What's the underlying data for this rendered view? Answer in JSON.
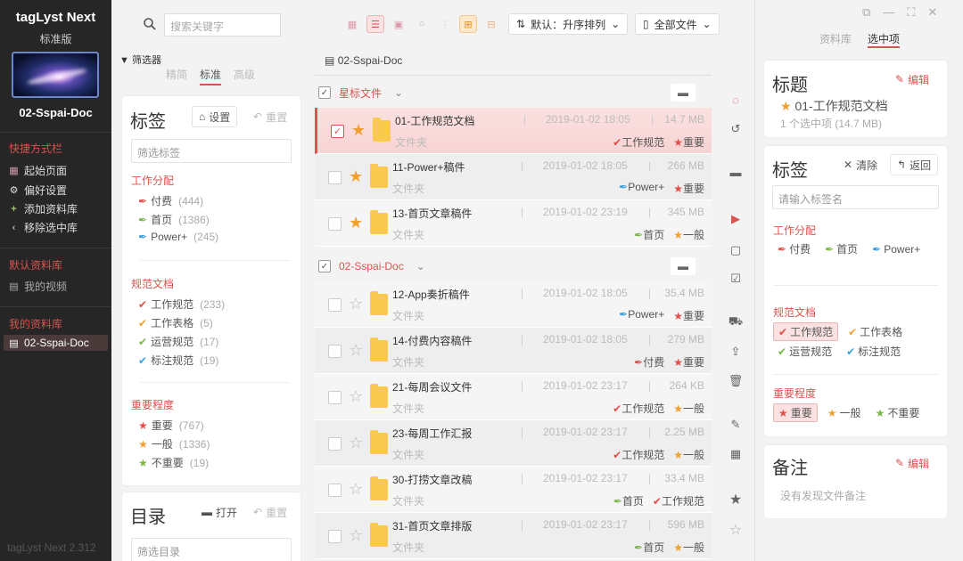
{
  "sidebar": {
    "app_title": "tagLyst Next",
    "edition": "标准版",
    "library_name": "02-Sspai-Doc",
    "shortcuts_title": "快捷方式栏",
    "shortcuts": [
      {
        "label": "起始页面",
        "icon": "grid-icon"
      },
      {
        "label": "偏好设置",
        "icon": "gear-icon"
      },
      {
        "label": "添加资料库",
        "icon": "plus-icon"
      },
      {
        "label": "移除选中库",
        "icon": "chevron-left-icon"
      }
    ],
    "default_libs_title": "默认资料库",
    "default_libs": [
      {
        "label": "我的视频"
      }
    ],
    "my_libs_title": "我的资料库",
    "my_libs": [
      {
        "label": "02-Sspai-Doc"
      }
    ],
    "version": "tagLyst Next 2.312"
  },
  "filter": {
    "search_placeholder": "搜索关键字",
    "label": "筛选器",
    "tabs": [
      "精简",
      "标准",
      "高级"
    ],
    "active_tab": 1,
    "tags_card": {
      "title": "标签",
      "settings": "设置",
      "reset": "重置",
      "input_placeholder": "筛选标签",
      "groups": [
        {
          "name": "工作分配",
          "items": [
            {
              "label": "付费",
              "count": "(444)",
              "color": "#e0504a",
              "icon": "pen-icon"
            },
            {
              "label": "首页",
              "count": "(1386)",
              "color": "#7ab648",
              "icon": "pen-icon"
            },
            {
              "label": "Power+",
              "count": "(245)",
              "color": "#3aa0e0",
              "icon": "pen-icon"
            }
          ]
        },
        {
          "name": "规范文档",
          "items": [
            {
              "label": "工作规范",
              "count": "(233)",
              "color": "#e0504a",
              "icon": "check-icon"
            },
            {
              "label": "工作表格",
              "count": "(5)",
              "color": "#f0a030",
              "icon": "check-icon"
            },
            {
              "label": "运营规范",
              "count": "(17)",
              "color": "#7ab648",
              "icon": "check-icon"
            },
            {
              "label": "标注规范",
              "count": "(19)",
              "color": "#3aa0e0",
              "icon": "check-icon"
            }
          ]
        },
        {
          "name": "重要程度",
          "items": [
            {
              "label": "重要",
              "count": "(767)",
              "color": "#e0504a",
              "icon": "star-icon"
            },
            {
              "label": "一般",
              "count": "(1336)",
              "color": "#f0a030",
              "icon": "star-icon"
            },
            {
              "label": "不重要",
              "count": "(19)",
              "color": "#7ab648",
              "icon": "star-icon"
            }
          ]
        }
      ]
    },
    "dir_card": {
      "title": "目录",
      "open": "打开",
      "reset": "重置",
      "input_placeholder": "筛选目录"
    }
  },
  "toolbar": {
    "sort_label": "默认：升序排列",
    "scope_label": "全部文件"
  },
  "main": {
    "path": "02-Sspai-Doc",
    "groups": [
      {
        "title": "星标文件",
        "rows": [
          {
            "name": "01-工作规范文档",
            "type": "文件夹",
            "date": "2019-01-02 18:05",
            "size": "14.7 MB",
            "starred": true,
            "selected": true,
            "tags": [
              {
                "label": "工作规范",
                "color": "#e0504a",
                "icon": "check-icon"
              },
              {
                "label": "重要",
                "color": "#e0504a",
                "icon": "star-icon"
              }
            ]
          },
          {
            "name": "11-Power+稿件",
            "type": "文件夹",
            "date": "2019-01-02 18:05",
            "size": "266 MB",
            "starred": true,
            "tags": [
              {
                "label": "Power+",
                "color": "#3aa0e0",
                "icon": "pen-icon"
              },
              {
                "label": "重要",
                "color": "#e0504a",
                "icon": "star-icon"
              }
            ]
          },
          {
            "name": "13-首页文章稿件",
            "type": "文件夹",
            "date": "2019-01-02 23:19",
            "size": "345 MB",
            "starred": true,
            "tags": [
              {
                "label": "首页",
                "color": "#7ab648",
                "icon": "pen-icon"
              },
              {
                "label": "一般",
                "color": "#f0a030",
                "icon": "star-icon"
              }
            ]
          }
        ]
      },
      {
        "title": "02-Sspai-Doc",
        "rows": [
          {
            "name": "12-App奏折稿件",
            "type": "文件夹",
            "date": "2019-01-02 18:05",
            "size": "35.4 MB",
            "starred": false,
            "tags": [
              {
                "label": "Power+",
                "color": "#3aa0e0",
                "icon": "pen-icon"
              },
              {
                "label": "重要",
                "color": "#e0504a",
                "icon": "star-icon"
              }
            ]
          },
          {
            "name": "14-付费内容稿件",
            "type": "文件夹",
            "date": "2019-01-02 18:05",
            "size": "279 MB",
            "starred": false,
            "tags": [
              {
                "label": "付费",
                "color": "#e0504a",
                "icon": "pen-icon"
              },
              {
                "label": "重要",
                "color": "#e0504a",
                "icon": "star-icon"
              }
            ]
          },
          {
            "name": "21-每周会议文件",
            "type": "文件夹",
            "date": "2019-01-02 23:17",
            "size": "264 KB",
            "starred": false,
            "tags": [
              {
                "label": "工作规范",
                "color": "#e0504a",
                "icon": "check-icon"
              },
              {
                "label": "一般",
                "color": "#f0a030",
                "icon": "star-icon"
              }
            ]
          },
          {
            "name": "23-每周工作汇报",
            "type": "文件夹",
            "date": "2019-01-02 23:17",
            "size": "2.25 MB",
            "starred": false,
            "tags": [
              {
                "label": "工作规范",
                "color": "#e0504a",
                "icon": "check-icon"
              },
              {
                "label": "一般",
                "color": "#f0a030",
                "icon": "star-icon"
              }
            ]
          },
          {
            "name": "30-打捞文章改稿",
            "type": "文件夹",
            "date": "2019-01-02 23:17",
            "size": "33.4 MB",
            "starred": false,
            "tags": [
              {
                "label": "首页",
                "color": "#7ab648",
                "icon": "pen-icon"
              },
              {
                "label": "工作规范",
                "color": "#e0504a",
                "icon": "check-icon"
              }
            ]
          },
          {
            "name": "31-首页文章排版",
            "type": "文件夹",
            "date": "2019-01-02 23:17",
            "size": "596 MB",
            "starred": false,
            "tags": [
              {
                "label": "首页",
                "color": "#7ab648",
                "icon": "pen-icon"
              },
              {
                "label": "一般",
                "color": "#f0a030",
                "icon": "star-icon"
              }
            ]
          }
        ]
      }
    ]
  },
  "right": {
    "tabs": [
      "资料库",
      "选中项"
    ],
    "active_tab": 1,
    "title_card": {
      "title": "标题",
      "edit": "编辑",
      "name": "01-工作规范文档",
      "subtitle": "1 个选中项 (14.7 MB)"
    },
    "tags_card": {
      "title": "标签",
      "clear": "清除",
      "back": "返回",
      "input_placeholder": "请输入标签名",
      "groups": [
        {
          "name": "工作分配",
          "items": [
            {
              "label": "付费",
              "color": "#e0504a",
              "icon": "pen-icon"
            },
            {
              "label": "首页",
              "color": "#7ab648",
              "icon": "pen-icon"
            },
            {
              "label": "Power+",
              "color": "#3aa0e0",
              "icon": "pen-icon"
            }
          ]
        },
        {
          "name": "规范文档",
          "items": [
            {
              "label": "工作规范",
              "color": "#e0504a",
              "icon": "check-icon",
              "on": true
            },
            {
              "label": "工作表格",
              "color": "#f0a030",
              "icon": "check-icon"
            },
            {
              "label": "运营规范",
              "color": "#7ab648",
              "icon": "check-icon"
            },
            {
              "label": "标注规范",
              "color": "#3aa0e0",
              "icon": "check-icon"
            }
          ]
        },
        {
          "name": "重要程度",
          "items": [
            {
              "label": "重要",
              "color": "#e0504a",
              "icon": "star-icon",
              "on": true
            },
            {
              "label": "一般",
              "color": "#f0a030",
              "icon": "star-icon"
            },
            {
              "label": "不重要",
              "color": "#7ab648",
              "icon": "star-icon"
            }
          ]
        }
      ]
    },
    "notes_card": {
      "title": "备注",
      "edit": "编辑",
      "empty": "没有发现文件备注"
    }
  }
}
